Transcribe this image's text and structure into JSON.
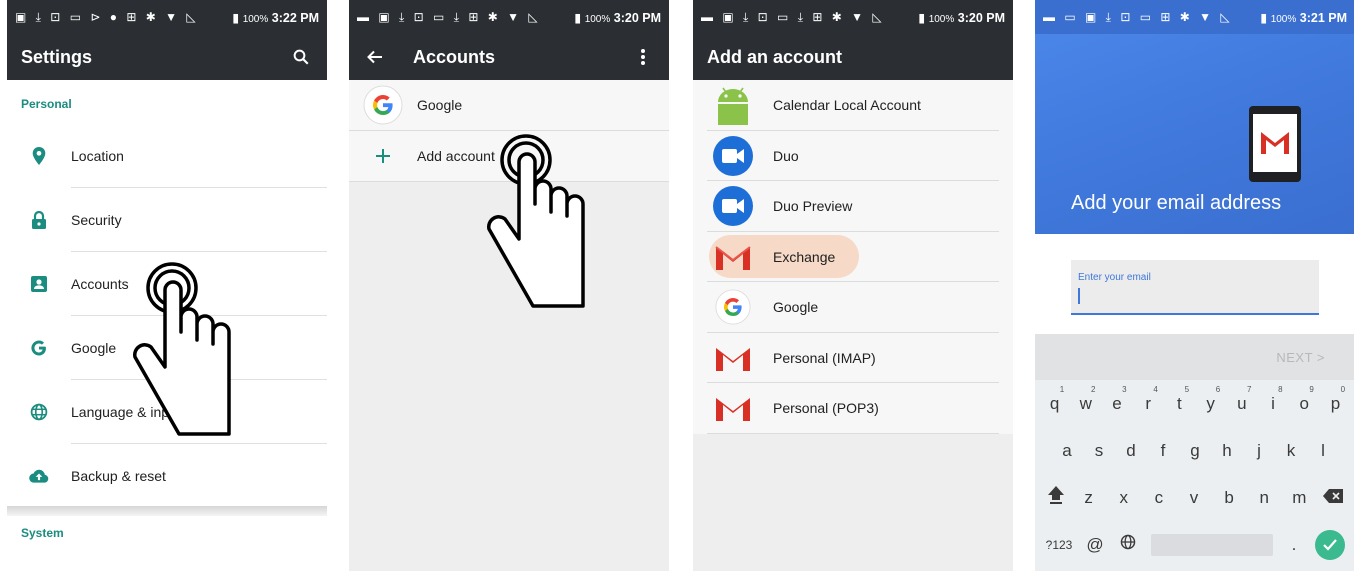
{
  "colors": {
    "status_bar": "#2b2f33",
    "accent_teal": "#1a8c80",
    "google_blue": "#3f77da",
    "exchange_highlight": "#f6d9c6",
    "enter_key_green": "#3bb98f"
  },
  "screen1": {
    "status_time": "3:22 PM",
    "battery": "100%",
    "title": "Settings",
    "search_icon": "search-icon",
    "section_personal": "Personal",
    "items": [
      {
        "label": "Location",
        "icon": "location-pin-icon"
      },
      {
        "label": "Security",
        "icon": "lock-icon"
      },
      {
        "label": "Accounts",
        "icon": "account-box-icon"
      },
      {
        "label": "Google",
        "icon": "google-g-icon"
      },
      {
        "label": "Language & input",
        "icon": "globe-icon"
      },
      {
        "label": "Backup & reset",
        "icon": "cloud-upload-icon"
      }
    ],
    "section_system": "System"
  },
  "screen2": {
    "status_time": "3:20 PM",
    "battery": "100%",
    "title": "Accounts",
    "accounts": [
      {
        "label": "Google",
        "icon": "google-logo-icon"
      }
    ],
    "add_account_label": "Add account"
  },
  "screen3": {
    "status_time": "3:20 PM",
    "battery": "100%",
    "title": "Add an account",
    "options": [
      {
        "label": "Calendar Local Account",
        "icon": "android-icon"
      },
      {
        "label": "Duo",
        "icon": "duo-video-icon"
      },
      {
        "label": "Duo Preview",
        "icon": "duo-video-icon"
      },
      {
        "label": "Exchange",
        "icon": "gmail-icon",
        "highlighted": true
      },
      {
        "label": "Google",
        "icon": "google-logo-icon"
      },
      {
        "label": "Personal (IMAP)",
        "icon": "gmail-icon"
      },
      {
        "label": "Personal (POP3)",
        "icon": "gmail-icon"
      }
    ]
  },
  "screen4": {
    "status_time": "3:21 PM",
    "battery": "100%",
    "heading": "Add your email address",
    "email_placeholder": "Enter your email",
    "email_value": "",
    "next_label": "NEXT >",
    "keyboard": {
      "row1": [
        {
          "k": "q",
          "n": "1"
        },
        {
          "k": "w",
          "n": "2"
        },
        {
          "k": "e",
          "n": "3"
        },
        {
          "k": "r",
          "n": "4"
        },
        {
          "k": "t",
          "n": "5"
        },
        {
          "k": "y",
          "n": "6"
        },
        {
          "k": "u",
          "n": "7"
        },
        {
          "k": "i",
          "n": "8"
        },
        {
          "k": "o",
          "n": "9"
        },
        {
          "k": "p",
          "n": "0"
        }
      ],
      "row2": [
        "a",
        "s",
        "d",
        "f",
        "g",
        "h",
        "j",
        "k",
        "l"
      ],
      "row3": [
        "z",
        "x",
        "c",
        "v",
        "b",
        "n",
        "m"
      ],
      "sym_label": "?123",
      "at_label": "@",
      "period_label": "."
    }
  }
}
